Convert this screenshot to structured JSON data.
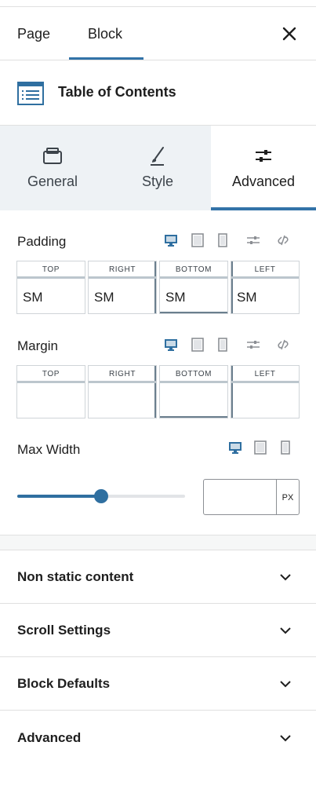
{
  "header": {
    "tabs": [
      {
        "label": "Page"
      },
      {
        "label": "Block"
      }
    ],
    "close_icon": "close-icon"
  },
  "block": {
    "title": "Table of Contents",
    "icon": "table-of-contents-icon"
  },
  "inspector_tabs": [
    {
      "label": "General",
      "icon": "general-icon"
    },
    {
      "label": "Style",
      "icon": "brush-icon"
    },
    {
      "label": "Advanced",
      "icon": "sliders-icon",
      "active": true
    }
  ],
  "padding": {
    "label": "Padding",
    "sides": [
      {
        "label": "TOP",
        "value": "SM"
      },
      {
        "label": "RIGHT",
        "value": "SM"
      },
      {
        "label": "BOTTOM",
        "value": "SM"
      },
      {
        "label": "LEFT",
        "value": "SM"
      }
    ]
  },
  "margin": {
    "label": "Margin",
    "sides": [
      {
        "label": "TOP",
        "value": ""
      },
      {
        "label": "RIGHT",
        "value": ""
      },
      {
        "label": "BOTTOM",
        "value": ""
      },
      {
        "label": "LEFT",
        "value": ""
      }
    ]
  },
  "max_width": {
    "label": "Max Width",
    "slider_fraction": 0.5,
    "value": "",
    "unit": "PX"
  },
  "panels": [
    {
      "title": "Non static content"
    },
    {
      "title": "Scroll Settings"
    },
    {
      "title": "Block Defaults"
    },
    {
      "title": "Advanced"
    }
  ],
  "colors": {
    "accent": "#3373a8",
    "device_active": "#2f6fa0",
    "device_inactive": "#8c8f94"
  }
}
